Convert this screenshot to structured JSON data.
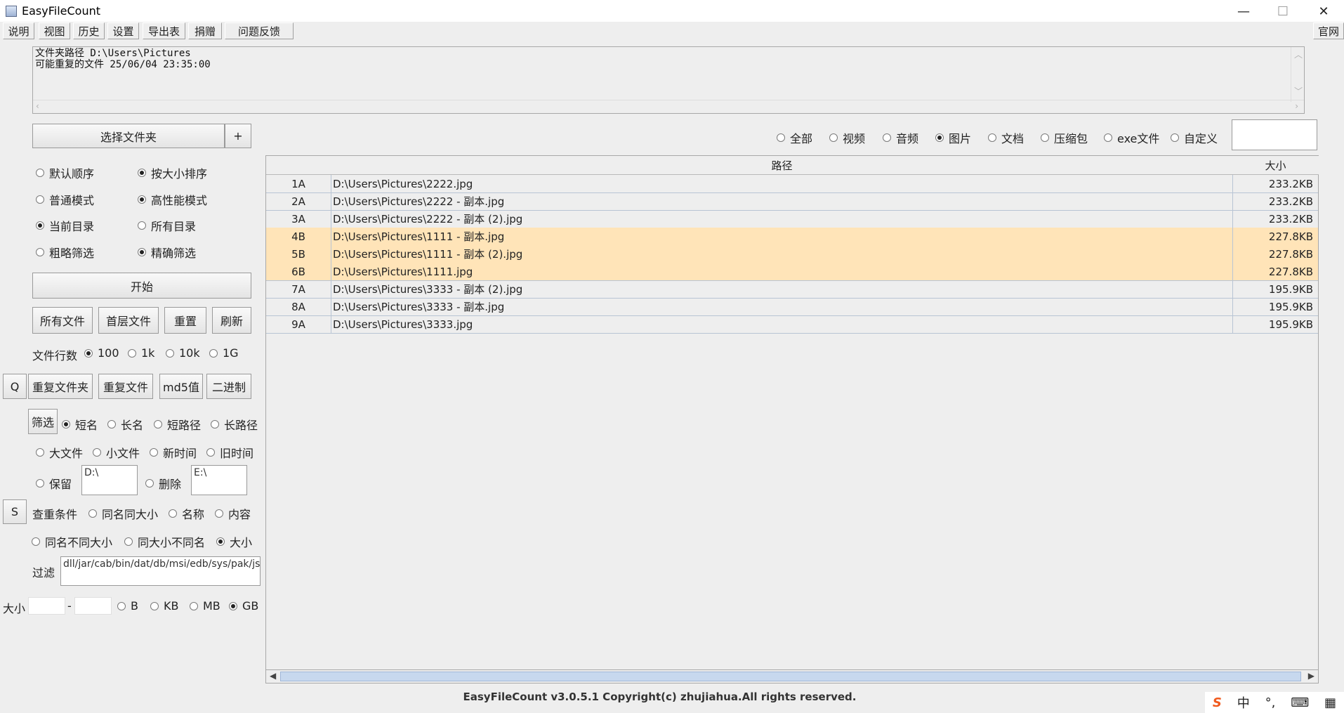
{
  "window": {
    "title": "EasyFileCount",
    "minimize": "—",
    "maximize": "☐",
    "close": "✕"
  },
  "menu": [
    "说明",
    "视图",
    "历史",
    "设置",
    "导出表",
    "捐赠",
    "问题反馈"
  ],
  "menu_right": "官网",
  "console": {
    "line1": "文件夹路径 D:\\Users\\Pictures",
    "line2": "可能重复的文件 25/06/04 23:35:00"
  },
  "left": {
    "choose_folder": "选择文件夹",
    "plus": "+",
    "opts": {
      "default_order": "默认顺序",
      "size_sort": "按大小排序",
      "normal_mode": "普通模式",
      "perf_mode": "高性能模式",
      "current_dir": "当前目录",
      "all_dirs": "所有目录",
      "rough": "粗略筛选",
      "precise": "精确筛选"
    },
    "start": "开始",
    "btn_all_files": "所有文件",
    "btn_top_files": "首层文件",
    "btn_reset": "重置",
    "btn_refresh": "刷新",
    "rows_label": "文件行数",
    "rows_opts": [
      "100",
      "1k",
      "10k",
      "1G"
    ],
    "btn_q": "Q",
    "btn_dup_folder": "重复文件夹",
    "btn_dup_file": "重复文件",
    "btn_md5": "md5值",
    "btn_binary": "二进制",
    "btn_filter": "筛选",
    "name_opts": [
      "短名",
      "长名",
      "短路径",
      "长路径"
    ],
    "size_opts": [
      "大文件",
      "小文件",
      "新时间",
      "旧时间"
    ],
    "keep": "保留",
    "keep_value": "D:\\",
    "delete": "删除",
    "delete_value": "E:\\",
    "btn_s": "S",
    "cond_label": "查重条件",
    "cond_opts": [
      "同名同大小",
      "名称",
      "内容"
    ],
    "cond_opts2": [
      "同名不同大小",
      "同大小不同名",
      "大小"
    ],
    "filter_label": "过滤",
    "filter_value": "dll/jar/cab/bin/dat/db/msi/edb/sys/pak/jsa",
    "size_label": "大小",
    "dash": "-",
    "unit_opts": [
      "B",
      "KB",
      "MB",
      "GB"
    ]
  },
  "types": [
    "全部",
    "视频",
    "音频",
    "图片",
    "文档",
    "压缩包",
    "exe文件",
    "自定义"
  ],
  "selected_type": "图片",
  "table": {
    "headers": [
      "",
      "路径",
      "大小"
    ],
    "rows": [
      {
        "id": "1A",
        "path": "D:\\Users\\Pictures\\2222.jpg",
        "size": "233.2KB",
        "hl": false
      },
      {
        "id": "2A",
        "path": "D:\\Users\\Pictures\\2222 - 副本.jpg",
        "size": "233.2KB",
        "hl": false
      },
      {
        "id": "3A",
        "path": "D:\\Users\\Pictures\\2222 - 副本 (2).jpg",
        "size": "233.2KB",
        "hl": false
      },
      {
        "id": "4B",
        "path": "D:\\Users\\Pictures\\1111 - 副本.jpg",
        "size": "227.8KB",
        "hl": true
      },
      {
        "id": "5B",
        "path": "D:\\Users\\Pictures\\1111 - 副本 (2).jpg",
        "size": "227.8KB",
        "hl": true
      },
      {
        "id": "6B",
        "path": "D:\\Users\\Pictures\\1111.jpg",
        "size": "227.8KB",
        "hl": true
      },
      {
        "id": "7A",
        "path": "D:\\Users\\Pictures\\3333 - 副本 (2).jpg",
        "size": "195.9KB",
        "hl": false
      },
      {
        "id": "8A",
        "path": "D:\\Users\\Pictures\\3333 - 副本.jpg",
        "size": "195.9KB",
        "hl": false
      },
      {
        "id": "9A",
        "path": "D:\\Users\\Pictures\\3333.jpg",
        "size": "195.9KB",
        "hl": false
      }
    ]
  },
  "footer": "EasyFileCount v3.0.5.1 Copyright(c) zhujiahua.All rights reserved.",
  "ime": {
    "logo": "S",
    "lang": "中",
    "punct": "°,",
    "keyboard": "⌨",
    "grid": "▦"
  },
  "colors": {
    "highlight_row": "#ffe4b8",
    "scroll_thumb": "#c7d8ee"
  }
}
